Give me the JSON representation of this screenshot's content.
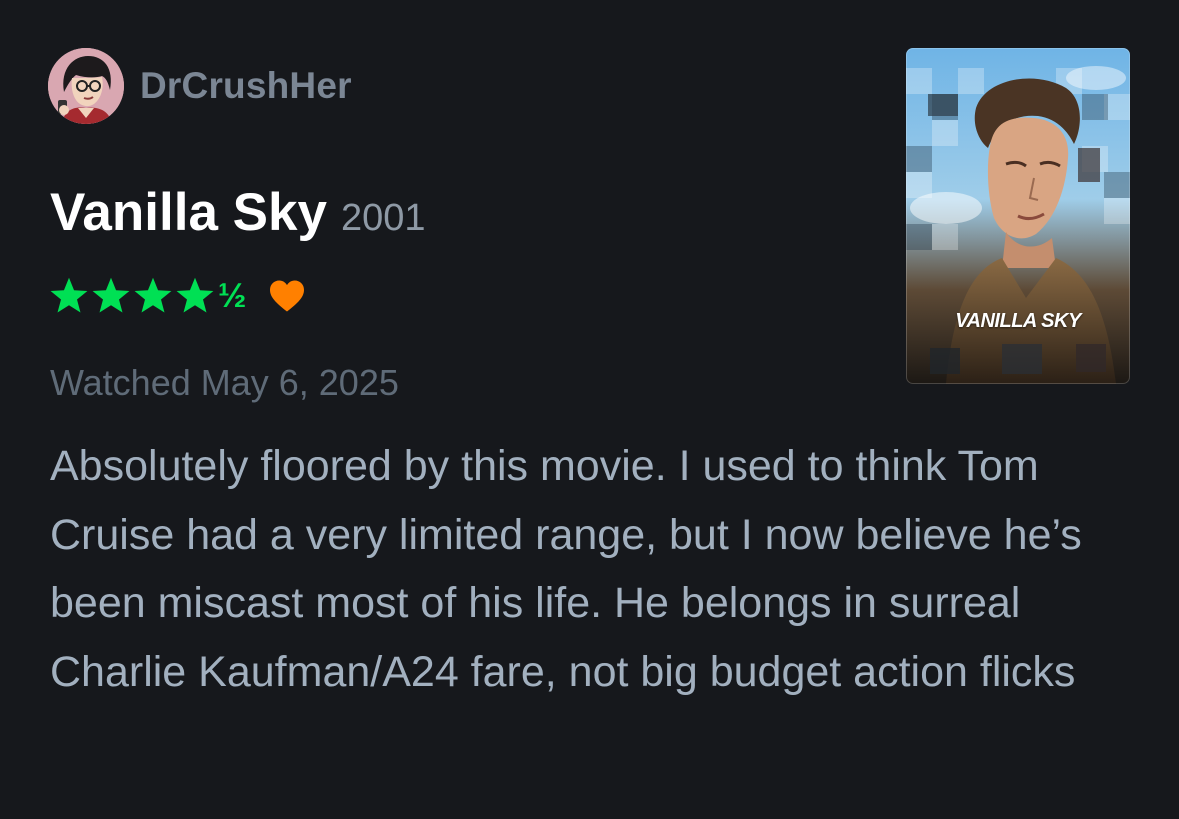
{
  "user": {
    "username": "DrCrushHer",
    "avatar_icon": "cartoon-portrait-avatar"
  },
  "film": {
    "title": "Vanilla Sky",
    "year": "2001",
    "poster_title": "VANILLA SKY"
  },
  "rating": {
    "stars": 4.5,
    "half_symbol": "½",
    "liked": true,
    "star_color": "#00e054",
    "heart_color": "#ff8000"
  },
  "watched_text": "Watched May 6, 2025",
  "review_text": "Absolutely floored by this movie. I used to think Tom Cruise had a very limited range, but I now believe he’s been miscast most of his life. He belongs in surreal Charlie Kaufman/A24 fare, not big budget action flicks",
  "colors": {
    "background": "#16181c",
    "title": "#ffffff",
    "muted_text": "#a2b0bf"
  }
}
